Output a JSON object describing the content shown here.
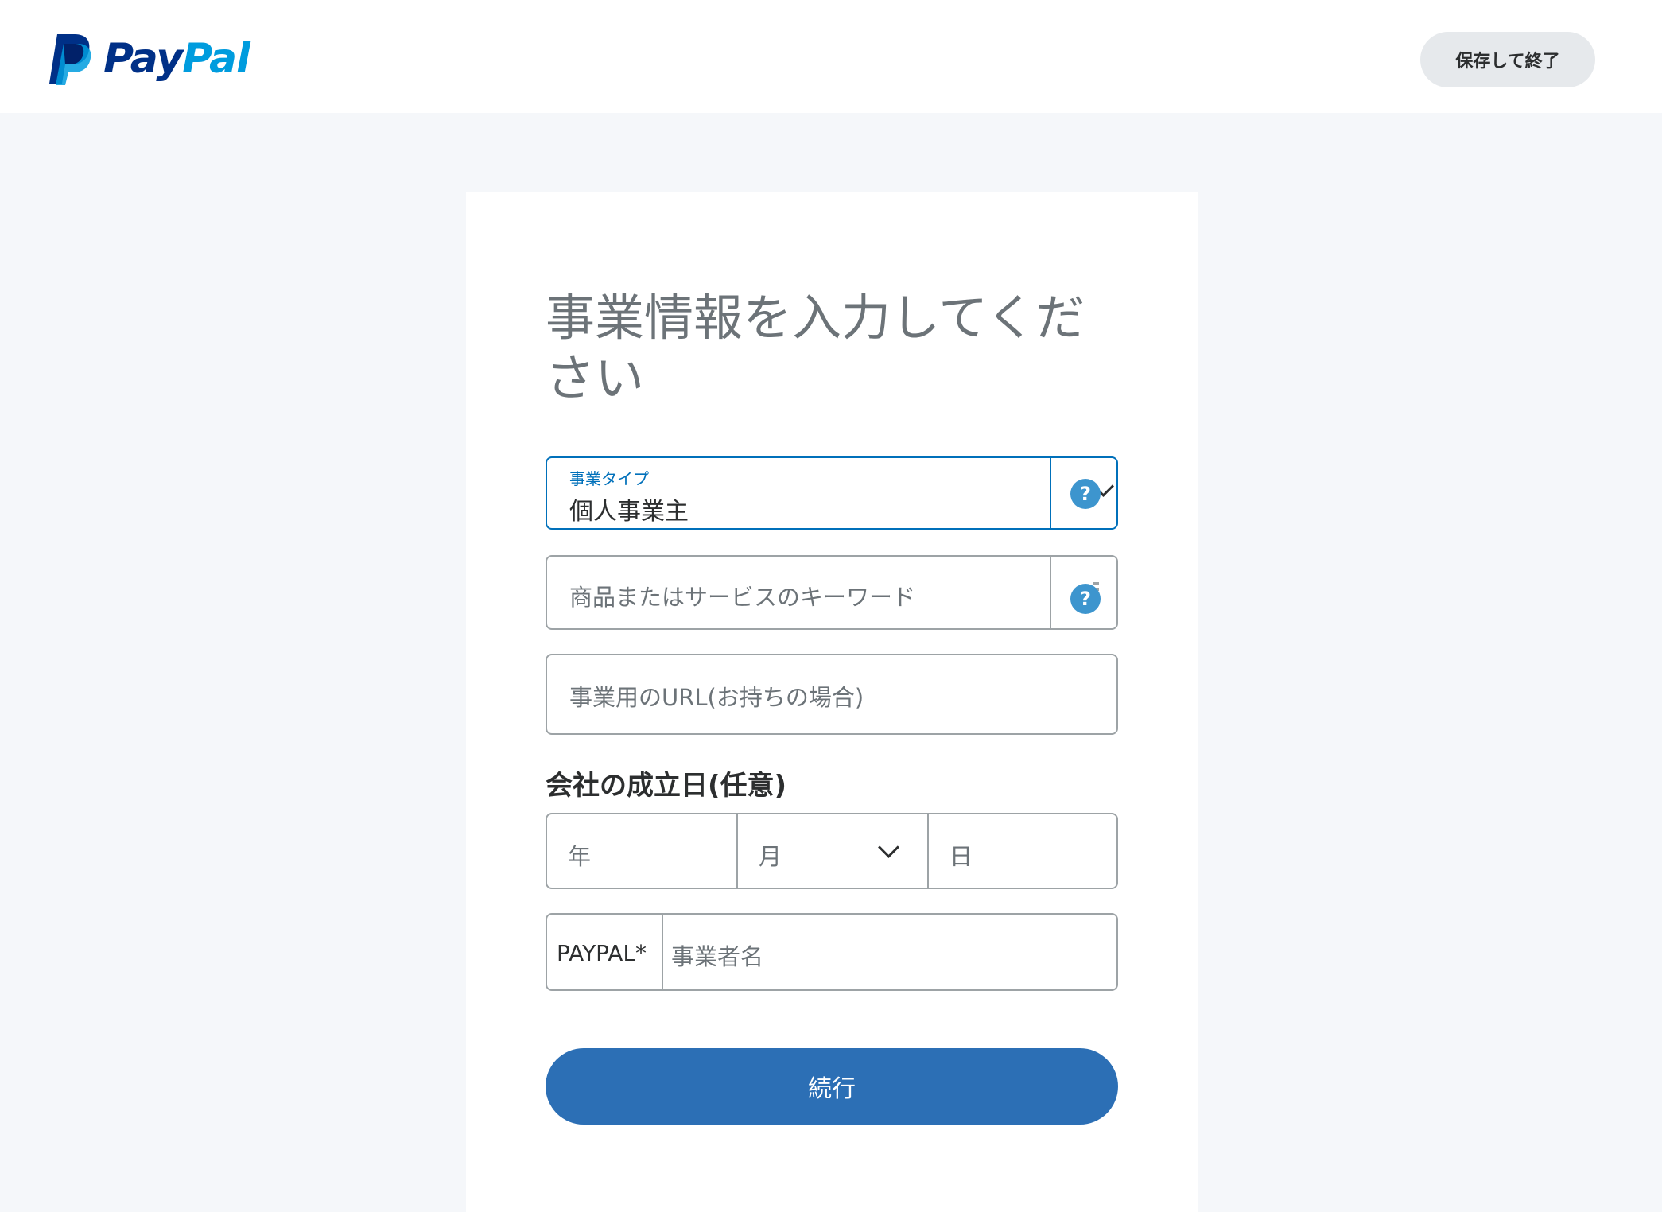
{
  "header": {
    "logo_pay": "Pay",
    "logo_pal": "Pal",
    "save_exit_label": "保存して終了"
  },
  "form": {
    "title": "事業情報を入力してください",
    "business_type": {
      "label": "事業タイプ",
      "value": "個人事業主",
      "help_icon": "?"
    },
    "keyword": {
      "placeholder": "商品またはサービスのキーワード",
      "help_icon": "?"
    },
    "url": {
      "placeholder": "事業用のURL(お持ちの場合)"
    },
    "founding_date": {
      "label": "会社の成立日(任意)",
      "year_placeholder": "年",
      "month_placeholder": "月",
      "day_placeholder": "日"
    },
    "business_name": {
      "prefix": "PAYPAL*",
      "placeholder": "事業者名"
    },
    "continue_label": "続行"
  },
  "colors": {
    "brand_dark": "#003087",
    "brand_light": "#009cde",
    "focus": "#0070ba",
    "primary_button": "#2c6fb5",
    "help_icon": "#3d95ce"
  }
}
